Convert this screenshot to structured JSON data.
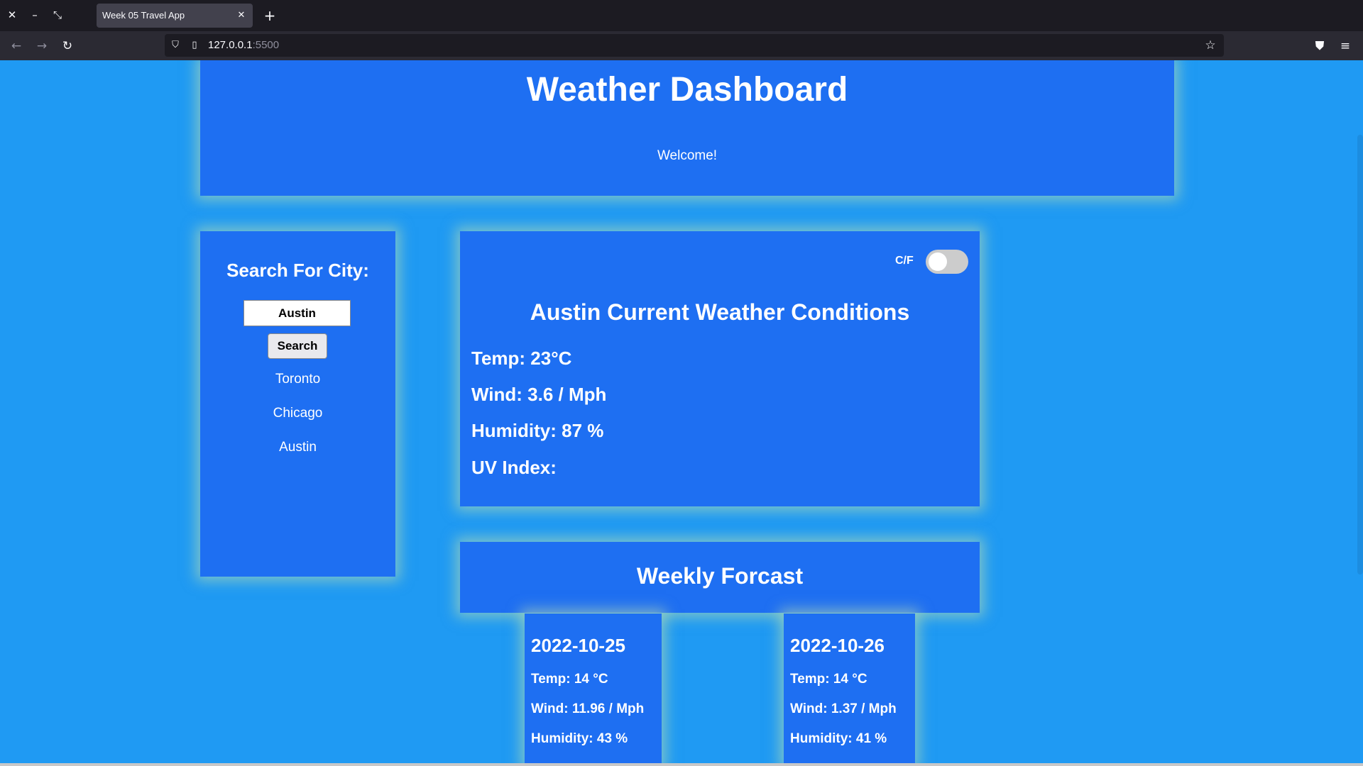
{
  "browser": {
    "tab_title": "Week 05 Travel App",
    "url_host": "127.0.0.1",
    "url_port": ":5500",
    "icons": [
      "close-icon",
      "minimize-icon",
      "restore-icon",
      "plus-icon",
      "back-arrow-icon",
      "forward-arrow-icon",
      "reload-icon",
      "shield-icon",
      "page-icon",
      "star-icon",
      "pocket-icon",
      "hamburger-menu-icon"
    ]
  },
  "header": {
    "title": "Weather Dashboard",
    "welcome": "Welcome!"
  },
  "search": {
    "heading": "Search For City:",
    "input_value": "Austin",
    "button_label": "Search",
    "history": [
      "Toronto",
      "Chicago",
      "Austin"
    ]
  },
  "current": {
    "unit_toggle_label": "C/F",
    "unit_toggle_on": false,
    "title": "Austin Current Weather Conditions",
    "temp": "Temp: 23°C",
    "wind": "Wind: 3.6 / Mph",
    "humidity": "Humidity: 87 %",
    "uv": "UV Index:"
  },
  "weekly": {
    "title": "Weekly Forcast",
    "days": [
      {
        "date": "2022-10-25",
        "temp": "Temp: 14 °C",
        "wind": "Wind: 11.96 / Mph",
        "humidity": "Humidity: 43 %"
      },
      {
        "date": "2022-10-26",
        "temp": "Temp: 14 °C",
        "wind": "Wind: 1.37 / Mph",
        "humidity": "Humidity: 41 %"
      }
    ]
  },
  "colors": {
    "page_background": "#1f9af3",
    "panel_background": "#1e6ff2",
    "panel_glow": "#c8e6aa",
    "text": "#ffffff"
  }
}
